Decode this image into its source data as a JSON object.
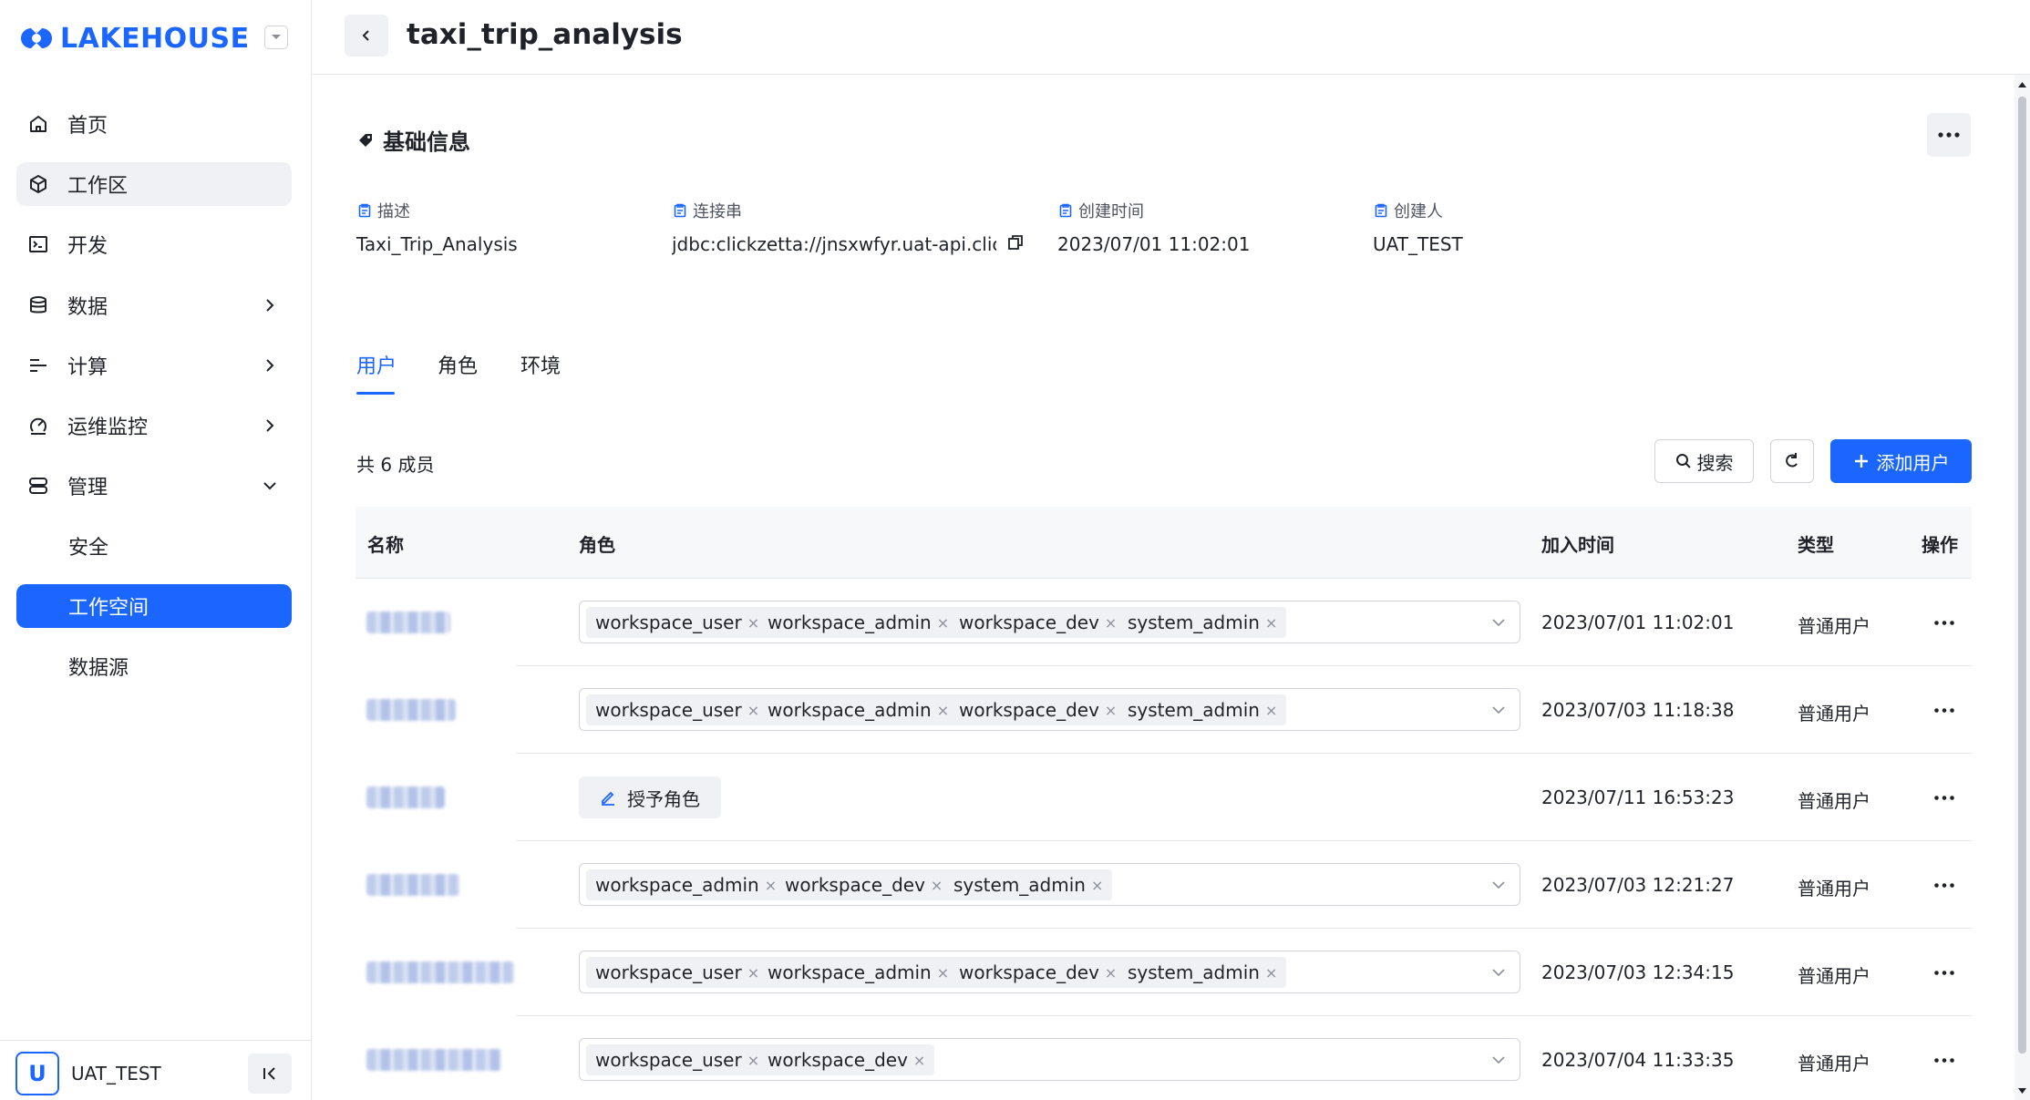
{
  "brand": {
    "name": "LAKEHOUSE",
    "color": "#1a66ff"
  },
  "sidebar": {
    "items": [
      {
        "label": "首页",
        "icon": "home-icon"
      },
      {
        "label": "工作区",
        "icon": "cube-icon"
      },
      {
        "label": "开发",
        "icon": "terminal-icon"
      },
      {
        "label": "数据",
        "icon": "database-icon"
      },
      {
        "label": "计算",
        "icon": "compute-icon"
      },
      {
        "label": "运维监控",
        "icon": "monitor-icon"
      },
      {
        "label": "管理",
        "icon": "server-icon"
      },
      {
        "label": "安全"
      },
      {
        "label": "工作空间"
      },
      {
        "label": "数据源"
      }
    ],
    "user": {
      "initial": "U",
      "name": "UAT_TEST"
    }
  },
  "header": {
    "title": "taxi_trip_analysis"
  },
  "basic_info": {
    "title": "基础信息",
    "fields": [
      {
        "label": "描述",
        "value": "Taxi_Trip_Analysis"
      },
      {
        "label": "连接串",
        "value": "jdbc:clickzetta://jnsxwfyr.uat-api.click..."
      },
      {
        "label": "创建时间",
        "value": "2023/07/01 11:02:01"
      },
      {
        "label": "创建人",
        "value": "UAT_TEST"
      }
    ]
  },
  "tabs": [
    "用户",
    "角色",
    "环境"
  ],
  "members": {
    "count_label": "共 6 成员",
    "search_label": "搜索",
    "add_label": "添加用户",
    "grant_label": "授予角色"
  },
  "table": {
    "headers": {
      "name": "名称",
      "role": "角色",
      "joined": "加入时间",
      "type": "类型",
      "action": "操作"
    },
    "rows": [
      {
        "roles": [
          "workspace_user",
          "workspace_admin",
          "workspace_dev",
          "system_admin"
        ],
        "joined": "2023/07/01 11:02:01",
        "type": "普通用户"
      },
      {
        "roles": [
          "workspace_user",
          "workspace_admin",
          "workspace_dev",
          "system_admin"
        ],
        "joined": "2023/07/03 11:18:38",
        "type": "普通用户"
      },
      {
        "roles": [],
        "joined": "2023/07/11 16:53:23",
        "type": "普通用户"
      },
      {
        "roles": [
          "workspace_admin",
          "workspace_dev",
          "system_admin"
        ],
        "joined": "2023/07/03 12:21:27",
        "type": "普通用户"
      },
      {
        "roles": [
          "workspace_user",
          "workspace_admin",
          "workspace_dev",
          "system_admin"
        ],
        "joined": "2023/07/03 12:34:15",
        "type": "普通用户"
      },
      {
        "roles": [
          "workspace_user",
          "workspace_dev"
        ],
        "joined": "2023/07/04 11:33:35",
        "type": "普通用户"
      }
    ]
  }
}
